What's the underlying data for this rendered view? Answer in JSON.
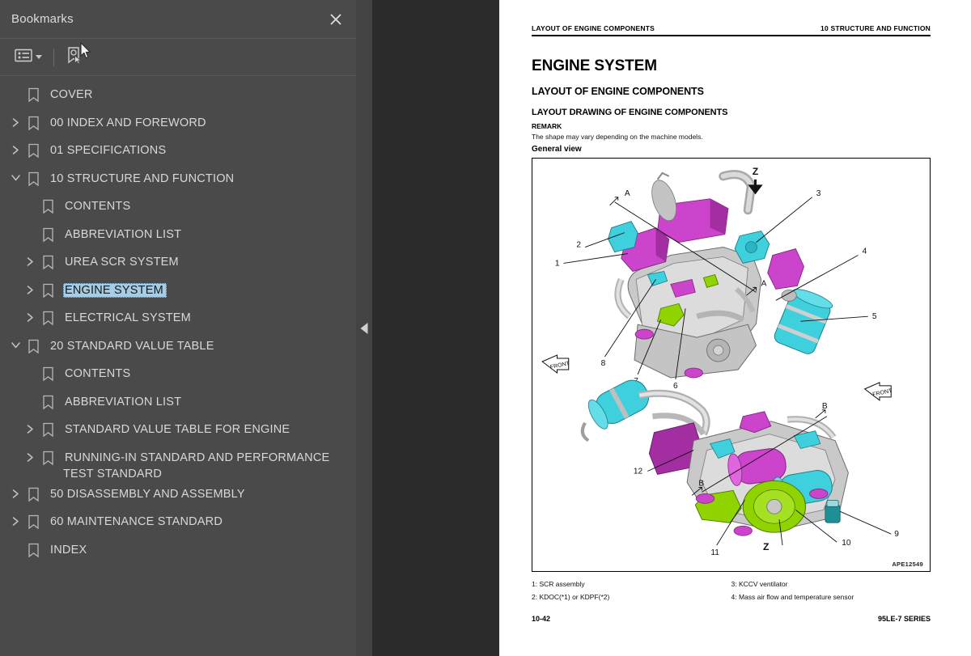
{
  "sidebar": {
    "title": "Bookmarks",
    "close_icon": "close-icon",
    "toolbar": {
      "options_icon": "list-options-icon",
      "options_caret": "chevron-down-icon",
      "new_bookmark_icon": "new-bookmark-icon"
    },
    "items": [
      {
        "label": "COVER",
        "level": 0,
        "twisty": "none",
        "selected": false
      },
      {
        "label": "00 INDEX AND FOREWORD",
        "level": 0,
        "twisty": "collapsed",
        "selected": false
      },
      {
        "label": "01 SPECIFICATIONS",
        "level": 0,
        "twisty": "collapsed",
        "selected": false
      },
      {
        "label": "10 STRUCTURE AND FUNCTION",
        "level": 0,
        "twisty": "expanded",
        "selected": false
      },
      {
        "label": "CONTENTS",
        "level": 1,
        "twisty": "none",
        "selected": false
      },
      {
        "label": "ABBREVIATION LIST",
        "level": 1,
        "twisty": "none",
        "selected": false
      },
      {
        "label": "UREA SCR SYSTEM",
        "level": 1,
        "twisty": "collapsed",
        "selected": false
      },
      {
        "label": "ENGINE SYSTEM",
        "level": 1,
        "twisty": "collapsed",
        "selected": true
      },
      {
        "label": "ELECTRICAL SYSTEM",
        "level": 1,
        "twisty": "collapsed",
        "selected": false
      },
      {
        "label": "20 STANDARD VALUE TABLE",
        "level": 0,
        "twisty": "expanded",
        "selected": false
      },
      {
        "label": "CONTENTS",
        "level": 1,
        "twisty": "none",
        "selected": false
      },
      {
        "label": "ABBREVIATION LIST",
        "level": 1,
        "twisty": "none",
        "selected": false
      },
      {
        "label": "STANDARD VALUE TABLE FOR ENGINE",
        "level": 1,
        "twisty": "collapsed",
        "selected": false
      },
      {
        "label": "RUNNING-IN STANDARD AND PERFORMANCE TEST STANDARD",
        "level": 1,
        "twisty": "collapsed",
        "selected": false
      },
      {
        "label": "50 DISASSEMBLY AND ASSEMBLY",
        "level": 0,
        "twisty": "collapsed",
        "selected": false
      },
      {
        "label": "60 MAINTENANCE STANDARD",
        "level": 0,
        "twisty": "collapsed",
        "selected": false
      },
      {
        "label": "INDEX",
        "level": 0,
        "twisty": "none",
        "selected": false
      }
    ]
  },
  "splitter": {
    "collapse_icon": "collapse-left-arrow-icon"
  },
  "page": {
    "header_left": "LAYOUT OF ENGINE COMPONENTS",
    "header_right": "10 STRUCTURE AND FUNCTION",
    "title": "ENGINE SYSTEM",
    "section": "LAYOUT OF ENGINE COMPONENTS",
    "subsection": "LAYOUT DRAWING OF ENGINE COMPONENTS",
    "remark_label": "REMARK",
    "remark_text": "The shape may vary depending on the machine models.",
    "figure_caption": "General view",
    "figure_code": "APE12549",
    "figure_labels": {
      "top": {
        "view_marker": "Z",
        "section_markers": [
          "A",
          "A"
        ],
        "orientation": "FRONT",
        "callouts": [
          "1",
          "2",
          "3",
          "4",
          "5",
          "6",
          "7",
          "8"
        ]
      },
      "bottom": {
        "view_marker": "Z",
        "section_markers": [
          "B",
          "B"
        ],
        "orientation": "FRONT",
        "callouts": [
          "9",
          "10",
          "11",
          "12"
        ]
      }
    },
    "legend_left": [
      "1: SCR assembly",
      "2: KDOC(*1) or KDPF(*2)"
    ],
    "legend_right": [
      "3: KCCV ventilator",
      "4: Mass air flow and temperature sensor"
    ],
    "footer_left": "10-42",
    "footer_right": "95LE-7 SERIES"
  },
  "colors": {
    "sidebar_bg": "#4a4a4a",
    "viewer_bg": "#2b2b2b",
    "selection": "#a5cde6",
    "text": "#d8d8d8",
    "engine_magenta": "#cc44cc",
    "engine_cyan": "#3fd0dd",
    "engine_green": "#8fd400",
    "engine_gray": "#bdbdbd"
  }
}
